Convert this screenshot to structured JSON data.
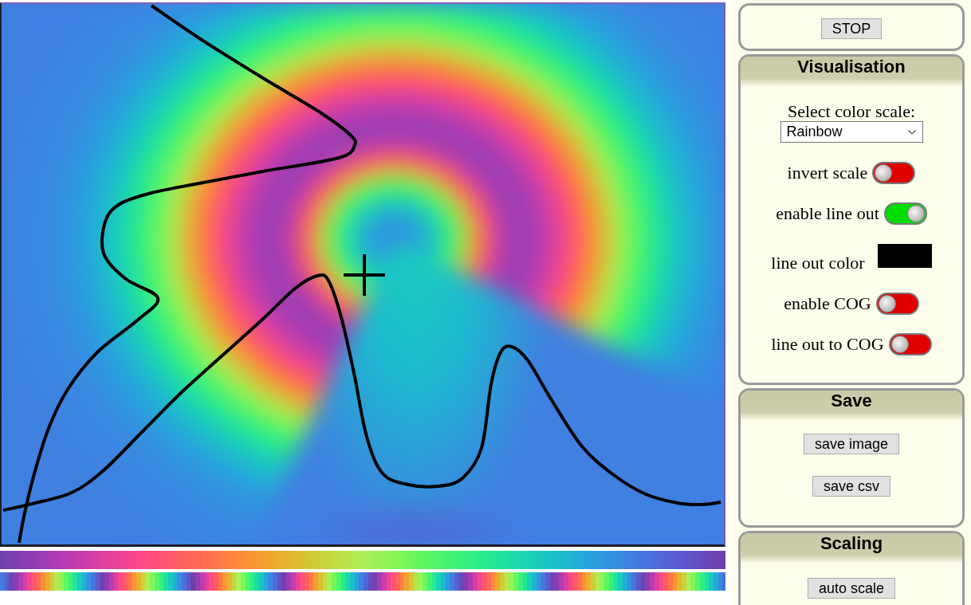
{
  "stop_panel": {
    "button": "STOP"
  },
  "visualisation": {
    "title": "Visualisation",
    "color_scale_label": "Select color scale:",
    "color_scale": "Rainbow",
    "settings": [
      {
        "kind": "toggle",
        "label": "invert scale",
        "on": false
      },
      {
        "kind": "toggle",
        "label": "enable line out",
        "on": true
      },
      {
        "kind": "color",
        "label": "line out color",
        "color": "#000000"
      },
      {
        "kind": "toggle",
        "label": "enable COG",
        "on": false
      },
      {
        "kind": "toggle",
        "label": "line out to COG",
        "on": false
      }
    ]
  },
  "save": {
    "title": "Save",
    "buttons": [
      "save image",
      "save csv"
    ]
  },
  "scaling": {
    "title": "Scaling",
    "buttons": [
      "auto scale"
    ]
  }
}
